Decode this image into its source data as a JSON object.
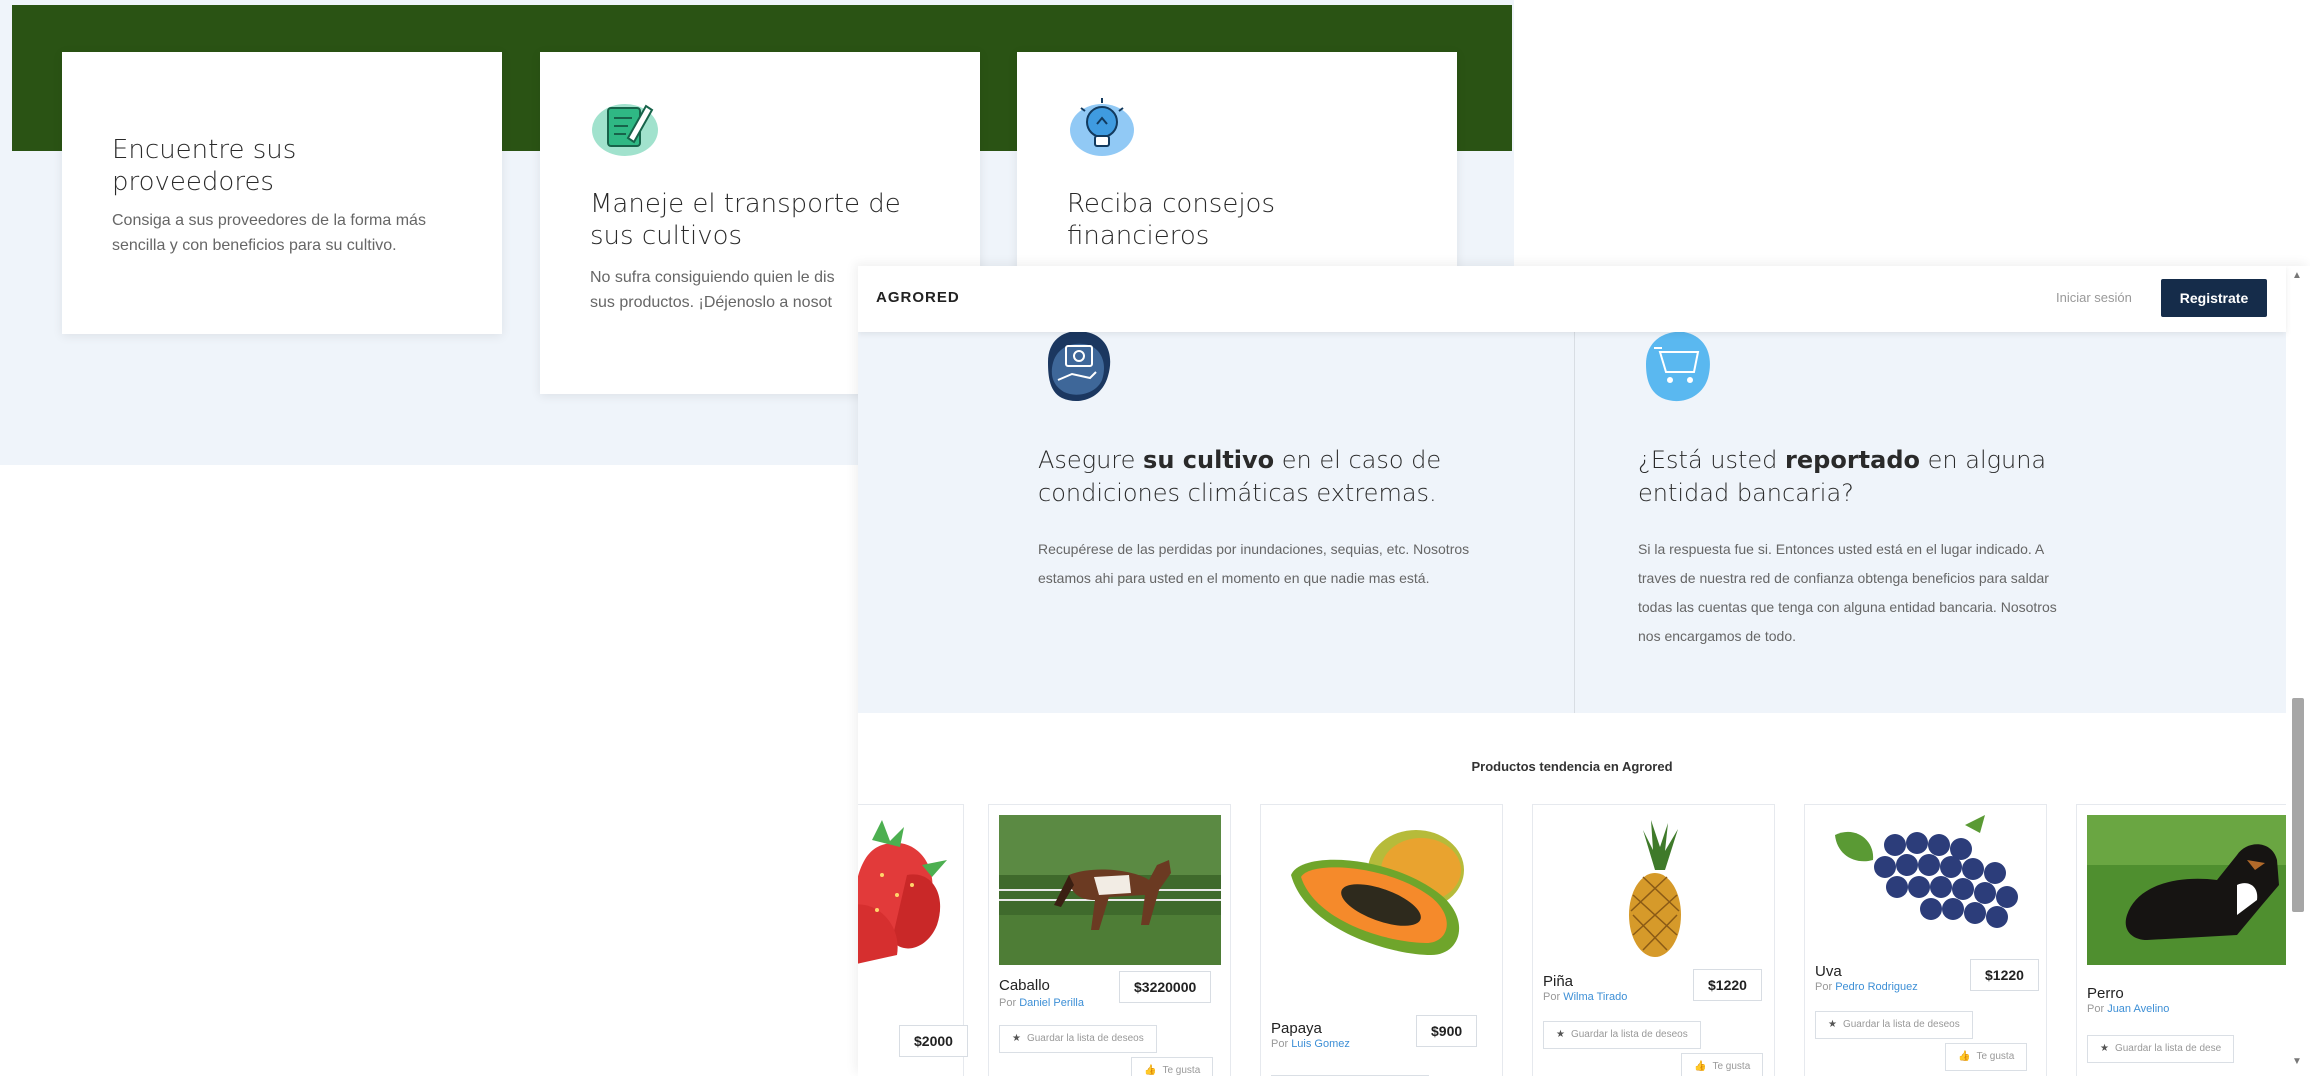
{
  "features": {
    "card1": {
      "title": "Encuentre sus proveedores",
      "text": "Consiga a sus proveedores de la forma más sencilla y con beneficios para su cultivo."
    },
    "card2": {
      "title": "Maneje el transporte de sus cultivos",
      "text_line1": "No sufra consiguiendo quien le dis",
      "text_line2": "sus productos. ¡Déjenoslo a nosot",
      "icon": "notepad-pencil-icon"
    },
    "card3": {
      "title": "Reciba consejos financieros",
      "icon": "lightbulb-icon"
    }
  },
  "navbar": {
    "brand": "AGRORED",
    "login": "Iniciar sesión",
    "register": "Registrate"
  },
  "services": {
    "insurance": {
      "title_pre": "Asegure ",
      "title_bold": "su cultivo",
      "title_post": " en el caso de condiciones climáticas extremas.",
      "text": "Recupérese de las perdidas por inundaciones, sequias, etc. Nosotros estamos ahi para usted en el momento en que nadie mas está.",
      "icon": "money-hand-icon"
    },
    "credit": {
      "title_pre": "¿Está usted ",
      "title_bold": "reportado",
      "title_post": " en alguna entidad bancaria?",
      "text": "Si la respuesta fue si. Entonces usted está en el lugar indicado. A traves de nuestra red de confianza obtenga beneficios para saldar todas las cuentas que tenga con alguna entidad bancaria. Nosotros nos encargamos de todo.",
      "icon": "shopping-cart-icon"
    }
  },
  "products": {
    "title": "Productos tendencia en Agrored",
    "wish_label": "Guardar la lista de deseos",
    "wish_label_cut": "Guardar la lista de dese",
    "like_label": "Te gusta",
    "by_prefix": "Por",
    "items": [
      {
        "name": "",
        "seller": "",
        "price": "$2000"
      },
      {
        "name": "Caballo",
        "seller": "Daniel Perilla",
        "price": "$3220000"
      },
      {
        "name": "Papaya",
        "seller": "Luis Gomez",
        "price": "$900"
      },
      {
        "name": "Piña",
        "seller": "Wilma Tirado",
        "price": "$1220"
      },
      {
        "name": "Uva",
        "seller": "Pedro Rodriguez",
        "price": "$1220"
      },
      {
        "name": "Perro",
        "seller": "Juan Avelino",
        "price": ""
      }
    ]
  },
  "colors": {
    "green_band": "#2a5314",
    "navy": "#152c4a",
    "link_blue": "#3d8fd6",
    "bg": "#eff4fa"
  }
}
